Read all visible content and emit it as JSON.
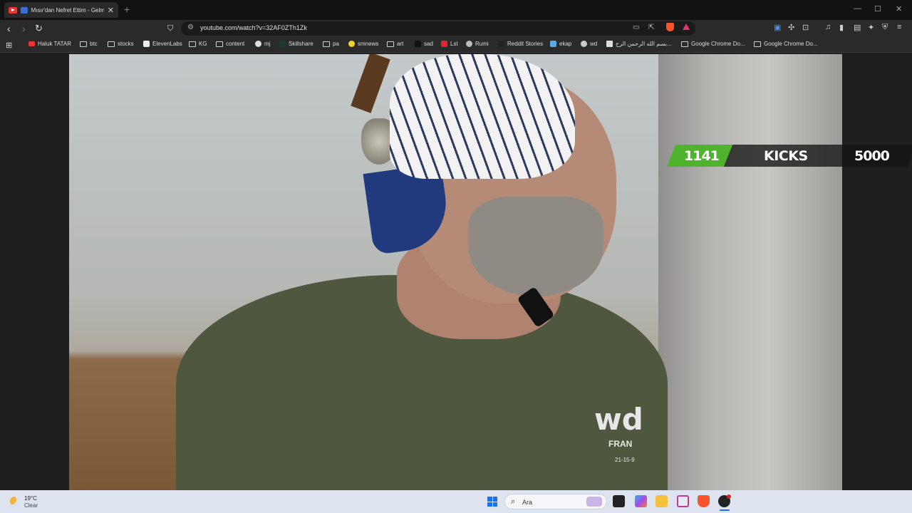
{
  "browser": {
    "tab": {
      "title": "Mısır'dan Nefret Ettim - Gelmeyin",
      "close": "✕"
    },
    "new_tab": "+",
    "window_controls": {
      "minimize": "—",
      "maximize": "☐",
      "close": "✕"
    },
    "url": "youtube.com/watch?v=32AF0ZTh1Zk"
  },
  "bookmarks": [
    {
      "label": "Haluk TATAR",
      "icon": "youtube-icon"
    },
    {
      "label": "btc",
      "icon": "folder-icon"
    },
    {
      "label": "stocks",
      "icon": "folder-icon"
    },
    {
      "label": "ElevenLabs",
      "icon": "elevenlabs-icon"
    },
    {
      "label": "KG",
      "icon": "folder-icon"
    },
    {
      "label": "content",
      "icon": "folder-icon"
    },
    {
      "label": "mj",
      "icon": "github-icon"
    },
    {
      "label": "Skillshare",
      "icon": "skillshare-icon"
    },
    {
      "label": "pa",
      "icon": "folder-icon"
    },
    {
      "label": "smnews",
      "icon": "smiley-icon"
    },
    {
      "label": "art",
      "icon": "folder-icon"
    },
    {
      "label": "sad",
      "icon": "v-icon"
    },
    {
      "label": "Lst",
      "icon": "s-icon"
    },
    {
      "label": "Rumi",
      "icon": "globe-icon"
    },
    {
      "label": "Reddit Stories",
      "icon": "d-icon"
    },
    {
      "label": "ekap",
      "icon": "ekap-icon"
    },
    {
      "label": "wd",
      "icon": "wordpress-icon"
    },
    {
      "label": "بسم الله الرحمن الرح...",
      "icon": "page-icon"
    },
    {
      "label": "Google Chrome Do...",
      "icon": "folder-icon"
    },
    {
      "label": "Google Chrome Do...",
      "icon": "folder-icon"
    }
  ],
  "video": {
    "overlay": {
      "count": "1141",
      "label": "KICKS",
      "goal": "5000"
    },
    "shirt_text": {
      "logo": "wd",
      "line1": "FRAN",
      "line2": "21-15-9"
    }
  },
  "taskbar": {
    "weather": {
      "temp": "19°C",
      "desc": "Clear"
    },
    "search_placeholder": "Ara"
  },
  "colors": {
    "accent_green": "#4fb32e",
    "youtube_red": "#e33"
  }
}
